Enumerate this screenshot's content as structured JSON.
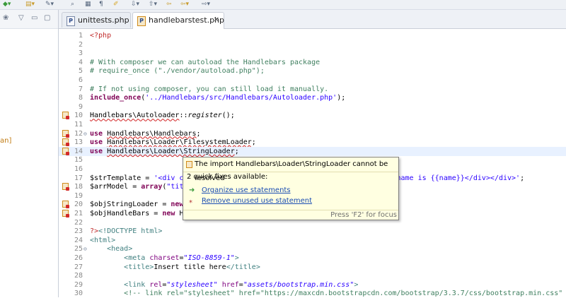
{
  "tabs": [
    {
      "label": "unittests.php",
      "icon": "php-file-icon",
      "active": false
    },
    {
      "label": "handlebarstest.php",
      "icon": "php-file-error-icon",
      "active": true
    }
  ],
  "left_pane": {
    "partial_text": "an]"
  },
  "code_lines": [
    {
      "n": "1",
      "html": "<span class=\"ph\">&lt;?php</span>"
    },
    {
      "n": "2",
      "html": ""
    },
    {
      "n": "3",
      "html": ""
    },
    {
      "n": "4",
      "html": "<span class=\"cm\"># With composer we can autoload the Handlebars package</span>"
    },
    {
      "n": "5",
      "html": "<span class=\"cm\"># require_once (\"./vendor/autoload.php\");</span>"
    },
    {
      "n": "6",
      "html": ""
    },
    {
      "n": "7",
      "html": "<span class=\"cm\"># If not using composer, you can still load it manually.</span>"
    },
    {
      "n": "8",
      "html": "<span class=\"kw\">include_once</span>(<span class=\"st\">'../Handlebars/src/Handlebars/Autoloader.php'</span>);"
    },
    {
      "n": "9",
      "html": ""
    },
    {
      "n": "10",
      "marker": true,
      "html": "<span class=\"err\">Handlebars\\Autoloader</span>::<span class=\"it\">register</span>();"
    },
    {
      "n": "11",
      "html": ""
    },
    {
      "n": "12",
      "marker": true,
      "fold": true,
      "html": "<span class=\"kw\">use</span> <span class=\"err\">Handlebars\\Handlebars</span>;"
    },
    {
      "n": "13",
      "marker": true,
      "html": "<span class=\"kw\">use</span> <span class=\"err\">Handlebars\\Loader\\FilesystemLoader</span>;"
    },
    {
      "n": "14",
      "marker": true,
      "current": true,
      "html": "<span class=\"kw\">use</span> <span class=\"err\">Handlebars\\Loader\\StringLoader</span>;"
    },
    {
      "n": "15",
      "html": ""
    },
    {
      "n": "16",
      "html": ""
    },
    {
      "n": "17",
      "html": "$strTemplate = <span class=\"st\">'&lt;div c                                          llo, my name is {{name}}&lt;/div&gt;&lt;/div&gt;'</span>;"
    },
    {
      "n": "18",
      "marker": true,
      "html": "$arrModel = <span class=\"kw\">array</span>(<span class=\"st\">\"tit</span>"
    },
    {
      "n": "19",
      "html": ""
    },
    {
      "n": "20",
      "marker": true,
      "html": "$objStringLoader = <span class=\"kw\">new</span>"
    },
    {
      "n": "21",
      "marker": true,
      "html": "$objHandleBars = <span class=\"kw\">new</span> H"
    },
    {
      "n": "22",
      "html": ""
    },
    {
      "n": "23",
      "html": "<span class=\"ph\">?&gt;</span><span class=\"tg\">&lt;!DOCTYPE html&gt;</span>"
    },
    {
      "n": "24",
      "html": "<span class=\"tg\">&lt;html&gt;</span>"
    },
    {
      "n": "25",
      "fold": true,
      "html": "    <span class=\"tg\">&lt;head&gt;</span>"
    },
    {
      "n": "26",
      "html": "        <span class=\"tg\">&lt;meta</span> <span class=\"at\">charset</span>=<span class=\"av\">\"ISO-8859-1\"</span><span class=\"tg\">&gt;</span>"
    },
    {
      "n": "27",
      "html": "        <span class=\"tg\">&lt;title&gt;</span>Insert title here<span class=\"tg\">&lt;/title&gt;</span>"
    },
    {
      "n": "28",
      "html": ""
    },
    {
      "n": "29",
      "html": "        <span class=\"tg\">&lt;link</span> <span class=\"at\">rel</span>=<span class=\"av\">\"stylesheet\"</span> <span class=\"at\">href</span>=<span class=\"av\">\"assets/bootstrap.min.css\"</span><span class=\"tg\">&gt;</span>"
    },
    {
      "n": "30",
      "html": "        <span class=\"cm\">&lt;!-- link rel=\"stylesheet\" href=\"https://maxcdn.bootstrapcdn.com/bootstrap/3.3.7/css/bootstrap.min.css\" in</span>"
    }
  ],
  "popup": {
    "title": "The import Handlebars\\Loader\\StringLoader cannot be resolved",
    "subtitle": "2 quick fixes available:",
    "fixes": [
      {
        "label": "Organize use statements",
        "icon": "organize-imports-icon"
      },
      {
        "label": "Remove unused use statement",
        "icon": "remove-icon"
      }
    ],
    "footer": "Press 'F2' for focus"
  }
}
